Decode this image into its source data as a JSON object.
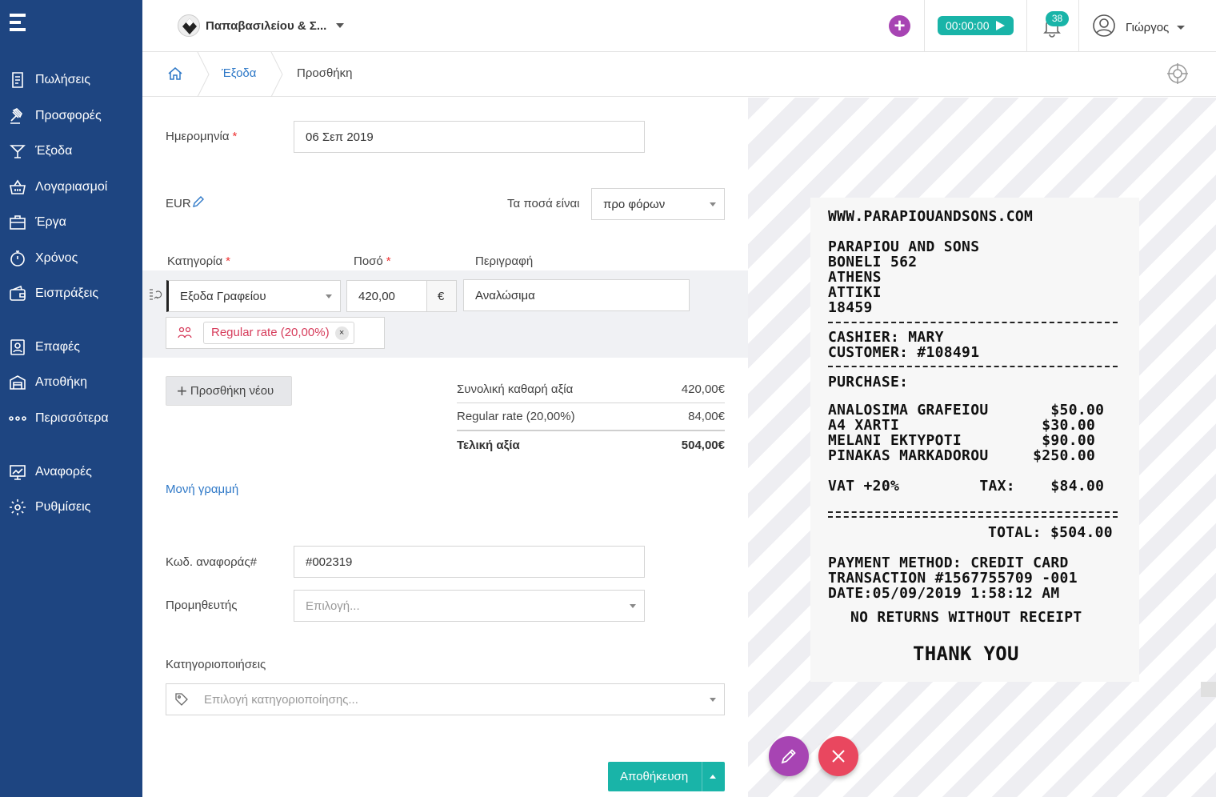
{
  "company": {
    "name": "Παπαβασιλείου & Σ..."
  },
  "topbar": {
    "timer": "00:00:00",
    "notifications": "38",
    "user_name": "Γιώργος"
  },
  "sidebar": {
    "items": [
      {
        "label": "Πωλήσεις",
        "icon": "invoice-icon"
      },
      {
        "label": "Προσφορές",
        "icon": "gavel-icon"
      },
      {
        "label": "Έξοδα",
        "icon": "cocktail-icon"
      },
      {
        "label": "Λογαριασμοί",
        "icon": "basket-icon"
      },
      {
        "label": "Έργα",
        "icon": "briefcase-icon"
      },
      {
        "label": "Χρόνος",
        "icon": "stopwatch-icon"
      },
      {
        "label": "Εισπράξεις",
        "icon": "wallet-icon"
      },
      {
        "label": "Επαφές",
        "icon": "contact-icon"
      },
      {
        "label": "Αποθήκη",
        "icon": "warehouse-icon"
      },
      {
        "label": "Περισσότερα",
        "icon": "more-dots-icon"
      },
      {
        "label": "Αναφορές",
        "icon": "reports-icon"
      },
      {
        "label": "Ρυθμίσεις",
        "icon": "gear-icon"
      }
    ]
  },
  "breadcrumb": {
    "parent": "Έξοδα",
    "current": "Προσθήκη"
  },
  "form": {
    "date_label": "Ημερομηνία",
    "date_value": "06 Σεπ 2019",
    "required_mark": "*",
    "currency": "EUR",
    "amounts_label": "Τα ποσά είναι",
    "amounts_value": "προ φόρων",
    "col_category": "Κατηγορία",
    "col_amount": "Ποσό",
    "col_description": "Περιγραφή",
    "line_category": "Εξοδα Γραφείου",
    "line_amount": "420,00",
    "line_currency_symbol": "€",
    "line_description": "Αναλώσιμα",
    "tax_tag": "Regular rate (20,00%)",
    "tag_remove": "×",
    "add_new": "Προσθήκη νέου",
    "single_line_link": "Μονή γραμμή",
    "ref_label": "Κωδ. αναφοράς#",
    "ref_value": "#002319",
    "supplier_label": "Προμηθευτής",
    "supplier_placeholder": "Επιλογή...",
    "classifications_label": "Κατηγοριοποιήσεις",
    "classifications_placeholder": "Επιλογή κατηγοριοποίησης...",
    "save": "Αποθήκευση"
  },
  "summary": {
    "net_label": "Συνολική καθαρή αξία",
    "net_value": "420,00€",
    "tax_label": "Regular rate (20,00%)",
    "tax_value": "84,00€",
    "total_label": "Τελική αξία",
    "total_value": "504,00€"
  },
  "receipt": {
    "lines": [
      "WWW.PARAPIOUANDSONS.COM",
      "PARAPIOU AND SONS",
      "BONELI 562",
      "ATHENS",
      "ATTIKI",
      "18459",
      "CASHIER: MARY",
      "CUSTOMER: #108491",
      "PURCHASE:",
      "ANALOSIMA GRAFEIOU       $50.00",
      "A4 XARTI                $30.00",
      "MELANI EKTYPOTI         $90.00",
      "PINAKAS MARKADOROU     $250.00",
      "VAT +20%         TAX:    $84.00",
      "TOTAL: $504.00",
      "PAYMENT METHOD: CREDIT CARD",
      "TRANSACTION #1567755709 -001",
      "DATE:05/09/2019 1:58:12 AM",
      "NO RETURNS WITHOUT RECEIPT",
      "THANK YOU"
    ]
  },
  "colors": {
    "sidebar": "#1e4581",
    "accent": "#19b4a8",
    "purple": "#a744b3",
    "red": "#e9475f",
    "link": "#2e78c7"
  }
}
